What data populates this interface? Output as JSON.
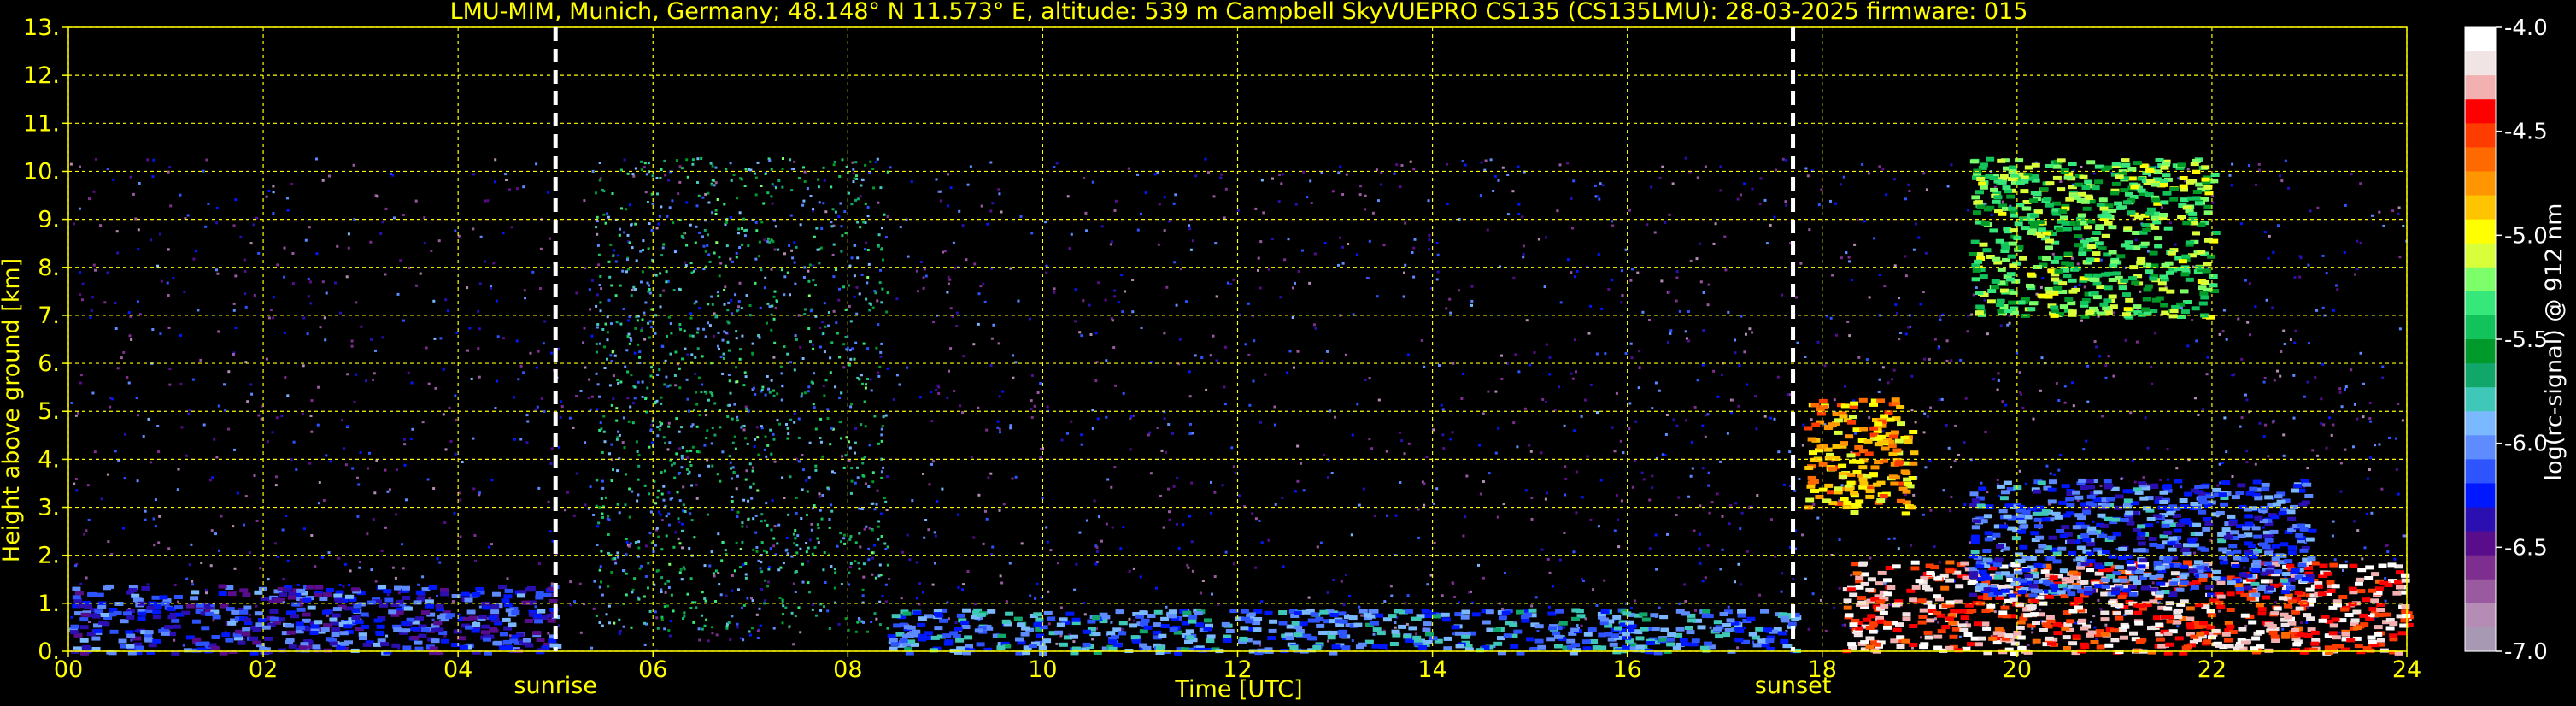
{
  "chart_data": {
    "type": "heatmap",
    "title": "LMU-MIM, Munich, Germany; 48.148° N 11.573° E, altitude: 539 m    Campbell SkyVUEPRO CS135 (CS135LMU): 28-03-2025    firmware: 015",
    "xlabel": "Time [UTC]",
    "ylabel": "Height above ground [km]",
    "x_ticks": [
      "00",
      "02",
      "04",
      "06",
      "08",
      "10",
      "12",
      "14",
      "16",
      "18",
      "20",
      "22",
      "24"
    ],
    "y_ticks": [
      "0.",
      "1.",
      "2.",
      "3.",
      "4.",
      "5.",
      "6.",
      "7.",
      "8.",
      "9.",
      "10.",
      "11.",
      "12.",
      "13."
    ],
    "xlim": [
      0,
      24
    ],
    "ylim": [
      0,
      13
    ],
    "grid": true,
    "grid_color": "#ffff00",
    "events": [
      {
        "label": "sunrise",
        "x": 5.0
      },
      {
        "label": "sunset",
        "x": 17.7
      }
    ],
    "colorbar": {
      "label": "log(rc-signal) @ 912 nm",
      "range": [
        -7.0,
        -4.0
      ],
      "ticks": [
        "-4.0",
        "-4.5",
        "-5.0",
        "-5.5",
        "-6.0",
        "-6.5",
        "-7.0"
      ],
      "colors": [
        "#ffffff",
        "#f0e4e4",
        "#f2b0b0",
        "#ff0000",
        "#ff3c00",
        "#ff6a00",
        "#ff9600",
        "#ffc400",
        "#ffff00",
        "#d8ff3a",
        "#7dff6a",
        "#36e87a",
        "#12c35c",
        "#009a2a",
        "#11a66a",
        "#3fc8b8",
        "#7ab8ff",
        "#5e8cff",
        "#2e54ff",
        "#0018ff",
        "#2c0fb0",
        "#5a0d8a",
        "#7d2e8e",
        "#9a5aa0",
        "#b58cb4",
        "#a799b4"
      ]
    },
    "signal_regions": [
      {
        "name": "upper noise",
        "x": [
          0,
          24
        ],
        "y": [
          0,
          10.3
        ],
        "level": -6.4
      },
      {
        "name": "dense noise band",
        "x": [
          5.4,
          8.4
        ],
        "y": [
          0.4,
          10.3
        ],
        "level": -5.7
      },
      {
        "name": "boundary layer aerosol morning",
        "x": [
          0,
          5.0
        ],
        "y": [
          0,
          1.4
        ],
        "level": -6.2
      },
      {
        "name": "boundary layer aerosol day",
        "x": [
          8.4,
          17.7
        ],
        "y": [
          0,
          0.9
        ],
        "level": -6.0
      },
      {
        "name": "cirrus cloud evening",
        "x": [
          17.8,
          18.9
        ],
        "y": [
          2.9,
          5.3
        ],
        "level": -4.8
      },
      {
        "name": "upper cirrus night",
        "x": [
          19.5,
          22.0
        ],
        "y": [
          7.0,
          10.3
        ],
        "level": -5.3
      },
      {
        "name": "low cloud layer",
        "x": [
          18.2,
          24.0
        ],
        "y": [
          0.0,
          1.9
        ],
        "level": -4.3
      },
      {
        "name": "mid level cloud",
        "x": [
          19.5,
          23.0
        ],
        "y": [
          1.2,
          3.6
        ],
        "level": -6.1
      }
    ]
  }
}
